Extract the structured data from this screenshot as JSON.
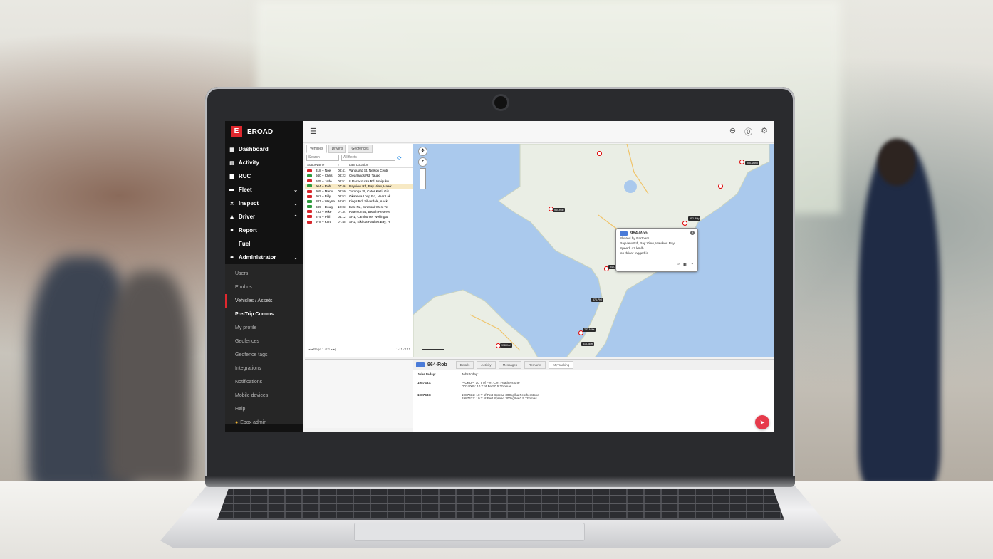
{
  "brand": {
    "name": "EROAD",
    "logo": "E",
    "accent": "#e0282e"
  },
  "nav": [
    {
      "label": "Dashboard",
      "icon": "grid-icon",
      "glyph": "▦",
      "chevron": ""
    },
    {
      "label": "Activity",
      "icon": "bars-icon",
      "glyph": "▤",
      "chevron": ""
    },
    {
      "label": "RUC",
      "icon": "doc-icon",
      "glyph": "▇",
      "chevron": ""
    },
    {
      "label": "Fleet",
      "icon": "truck-icon",
      "glyph": "▬",
      "chevron": "⌄"
    },
    {
      "label": "Inspect",
      "icon": "wrench-icon",
      "glyph": "✕",
      "chevron": "⌄"
    },
    {
      "label": "Driver",
      "icon": "person-icon",
      "glyph": "♟",
      "chevron": "⌃"
    },
    {
      "label": "Report",
      "icon": "report-icon",
      "glyph": "■",
      "chevron": ""
    },
    {
      "label": "Fuel",
      "icon": "fuel-icon",
      "glyph": "",
      "chevron": ""
    },
    {
      "label": "Administrator",
      "icon": "admin-icon",
      "glyph": "♣",
      "chevron": "⌄"
    }
  ],
  "admin_items": [
    {
      "label": "Users",
      "state": ""
    },
    {
      "label": "Ehubos",
      "state": ""
    },
    {
      "label": "Vehicles / Assets",
      "state": "active"
    },
    {
      "label": "Pre-Trip Comms",
      "state": "bold"
    },
    {
      "label": "My profile",
      "state": ""
    },
    {
      "label": "Geofences",
      "state": ""
    },
    {
      "label": "Geofence tags",
      "state": ""
    },
    {
      "label": "Integrations",
      "state": ""
    },
    {
      "label": "Notifications",
      "state": ""
    },
    {
      "label": "Mobile devices",
      "state": ""
    },
    {
      "label": "Help",
      "state": ""
    },
    {
      "label": "Ebox admin",
      "state": "dot"
    }
  ],
  "topbar": {
    "menu_icon": "☰",
    "icons": [
      "⊖",
      "⓪",
      "⚙"
    ]
  },
  "list": {
    "tabs": [
      "Vehicles",
      "Drivers",
      "Geofences"
    ],
    "search_placeholder": "Search",
    "filter_value": "All fleets",
    "headers": [
      "Status",
      "Name",
      "↑",
      "Last Location"
    ],
    "rows": [
      {
        "status": "red",
        "name": "318 – Noel",
        "time": "08:41",
        "loc": "Vanguard St, Nelson Centr"
      },
      {
        "status": "green",
        "name": "940 – Chris",
        "time": "08:23",
        "loc": "Clearlands Rd, Taupo"
      },
      {
        "status": "red",
        "name": "925 – Jade",
        "time": "08:51",
        "loc": "8 Racecourse Rd, Waipuku"
      },
      {
        "status": "green",
        "name": "964 – Rob",
        "time": "07:46",
        "loc": "Bayview Rd, Bay View, Hawk",
        "hl": true
      },
      {
        "status": "red",
        "name": "955 – Manu",
        "time": "08:50",
        "loc": "Turanga St, Cater Kaiti, Gis"
      },
      {
        "status": "red",
        "name": "952 – Billy",
        "time": "08:53",
        "loc": "Okarewa Loop Rd, Near Lak"
      },
      {
        "status": "green",
        "name": "887 – Wayne",
        "time": "10:03",
        "loc": "Kings Rd, Silverdale, Auck"
      },
      {
        "status": "green",
        "name": "689 – Doug",
        "time": "10:03",
        "loc": "East Rd, Stratford West Te"
      },
      {
        "status": "red",
        "name": "733 – Mike",
        "time": "07:34",
        "loc": "Paterson St, Beach Reserve"
      },
      {
        "status": "red",
        "name": "874 – Phil",
        "time": "04:12",
        "loc": "SH1, Camborne, Wellingto"
      },
      {
        "status": "red",
        "name": "978 – Kurt",
        "time": "07:45",
        "loc": "SH2, Kikirua Haukes Bay, H"
      }
    ],
    "pager_text": "|◂  ◂  Page 1 of 1  ▸  ▸|",
    "pager_count": "1-11 of 11"
  },
  "status_colors": {
    "red": "#d8262c",
    "green": "#2e9b3e"
  },
  "map": {
    "popup": {
      "title": "964-Rob",
      "line1": "Shared by Partners",
      "line2": "Bayview Rd, Bay View, Hawkes Bay",
      "line3": "Speed: 47 km/h",
      "line4": "No driver logged in"
    },
    "labels": [
      "964-Rob",
      "955-Manu",
      "874-Phil",
      "952-Billy",
      "733-Mike",
      "978-Kurt",
      "318-Noel",
      "940-Chris"
    ]
  },
  "detail": {
    "title": "964-Rob",
    "tabs": [
      "Details",
      "Activity",
      "Messages",
      "Remarks",
      "MyTracking"
    ],
    "selected_tab": "MyTracking",
    "jobs": [
      {
        "key": "Jobs today:",
        "value": "Jobs today:"
      },
      {
        "key": "1987433:",
        "value": "PICKUP: 10 T of Fert Cert Featherstone\nD024005: 10 T of Fert 0.5 Thomas"
      },
      {
        "key": "1987433:",
        "value": "1987432: 10 T of Fert Spread 300kg/ha Featherstone\n1987432: 10 T of Fert Spread 300kg/ha 0.5 Thomas"
      }
    ]
  }
}
